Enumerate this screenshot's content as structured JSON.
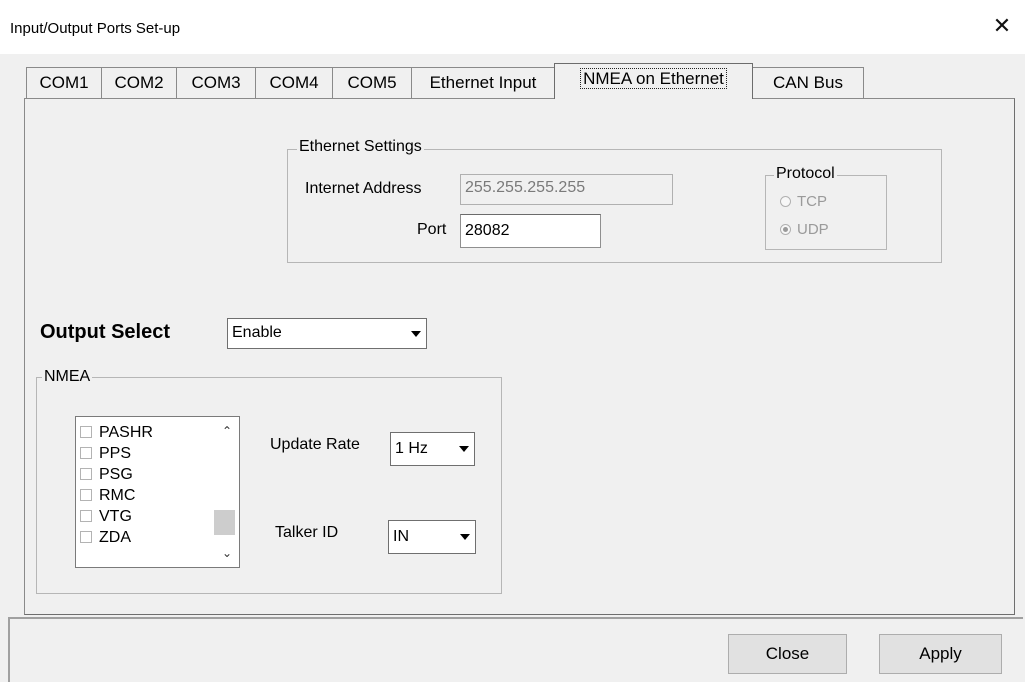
{
  "window": {
    "title": "Input/Output Ports Set-up",
    "close_glyph": "✕"
  },
  "tabs": [
    {
      "label": "COM1"
    },
    {
      "label": "COM2"
    },
    {
      "label": "COM3"
    },
    {
      "label": "COM4"
    },
    {
      "label": "COM5"
    },
    {
      "label": "Ethernet Input"
    },
    {
      "label": "NMEA on Ethernet",
      "active": true
    },
    {
      "label": "CAN Bus"
    }
  ],
  "ethernet": {
    "group_label": "Ethernet Settings",
    "address_label": "Internet Address",
    "address_value": "255.255.255.255",
    "port_label": "Port",
    "port_value": "28082"
  },
  "protocol": {
    "group_label": "Protocol",
    "options": [
      {
        "label": "TCP",
        "checked": false
      },
      {
        "label": "UDP",
        "checked": true
      }
    ]
  },
  "output_select": {
    "label": "Output Select",
    "value": "Enable"
  },
  "nmea": {
    "group_label": "NMEA",
    "messages": [
      {
        "label": "PASHR",
        "checked": false
      },
      {
        "label": "PPS",
        "checked": false
      },
      {
        "label": "PSG",
        "checked": false
      },
      {
        "label": "RMC",
        "checked": false
      },
      {
        "label": "VTG",
        "checked": false
      },
      {
        "label": "ZDA",
        "checked": false
      }
    ],
    "update_rate_label": "Update Rate",
    "update_rate_value": "1 Hz",
    "talker_id_label": "Talker ID",
    "talker_id_value": "IN"
  },
  "buttons": {
    "close": "Close",
    "apply": "Apply"
  },
  "icons": {
    "scroll_up": "chevron-up-icon",
    "scroll_down": "chevron-down-icon",
    "dropdown": "dropdown-arrow-icon"
  }
}
